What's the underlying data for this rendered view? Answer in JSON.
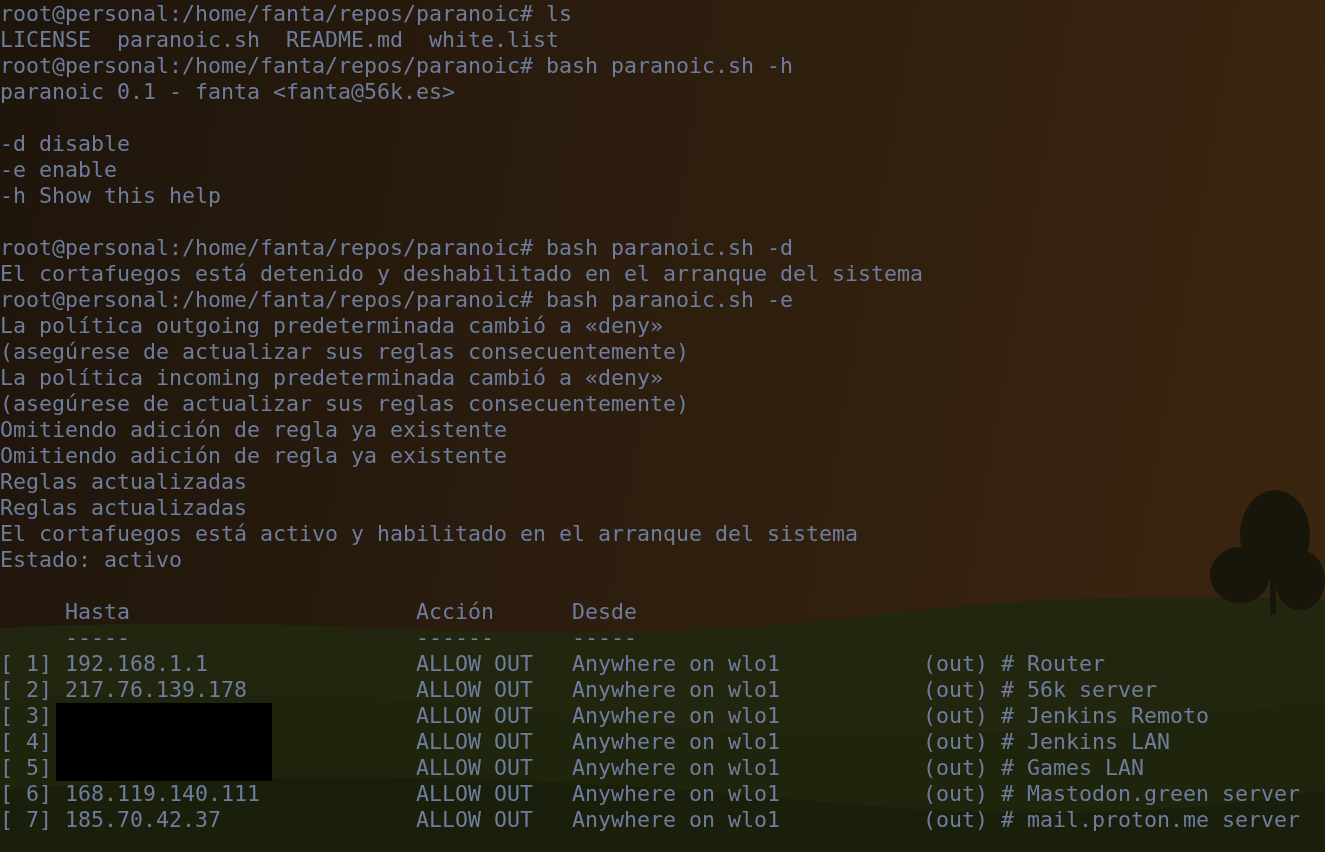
{
  "terminal": {
    "blocks": [
      [
        "root@personal:/home/fanta/repos/paranoic# ls",
        "LICENSE  paranoic.sh  README.md  white.list",
        "root@personal:/home/fanta/repos/paranoic# bash paranoic.sh -h",
        "paranoic 0.1 - fanta <fanta@56k.es>"
      ],
      [
        "-d disable",
        "-e enable",
        "-h Show this help"
      ],
      [
        "root@personal:/home/fanta/repos/paranoic# bash paranoic.sh -d",
        "El cortafuegos está detenido y deshabilitado en el arranque del sistema",
        "root@personal:/home/fanta/repos/paranoic# bash paranoic.sh -e",
        "La política outgoing predeterminada cambió a «deny»",
        "(asegúrese de actualizar sus reglas consecuentemente)",
        "La política incoming predeterminada cambió a «deny»",
        "(asegúrese de actualizar sus reglas consecuentemente)",
        "Omitiendo adición de regla ya existente",
        "Omitiendo adición de regla ya existente",
        "Reglas actualizadas",
        "Reglas actualizadas",
        "El cortafuegos está activo y habilitado en el arranque del sistema",
        "Estado: activo"
      ]
    ],
    "rules_table": {
      "columns": [
        "Hasta",
        "Acción",
        "Desde"
      ],
      "underlines": [
        "-----",
        "------",
        "-----"
      ],
      "rows": [
        {
          "number": "[ 1]",
          "to": "192.168.1.1",
          "action": "ALLOW OUT",
          "from": "Anywhere on wlo1",
          "comment": "(out) # Router"
        },
        {
          "number": "[ 2]",
          "to": "217.76.139.178",
          "action": "ALLOW OUT",
          "from": "Anywhere on wlo1",
          "comment": "(out) # 56k server"
        },
        {
          "number": "[ 3]",
          "redacted": true,
          "action": "ALLOW OUT",
          "from": "Anywhere on wlo1",
          "comment": "(out) # Jenkins Remoto"
        },
        {
          "number": "[ 4]",
          "redacted": true,
          "action": "ALLOW OUT",
          "from": "Anywhere on wlo1",
          "comment": "(out) # Jenkins LAN"
        },
        {
          "number": "[ 5]",
          "redacted": true,
          "action": "ALLOW OUT",
          "from": "Anywhere on wlo1",
          "comment": "(out) # Games LAN"
        },
        {
          "number": "[ 6]",
          "to": "168.119.140.111",
          "action": "ALLOW OUT",
          "from": "Anywhere on wlo1",
          "comment": "(out) # Mastodon.green server"
        },
        {
          "number": "[ 7]",
          "to": "185.70.42.37",
          "action": "ALLOW OUT",
          "from": "Anywhere on wlo1",
          "comment": "(out) # mail.proton.me server"
        }
      ]
    }
  }
}
